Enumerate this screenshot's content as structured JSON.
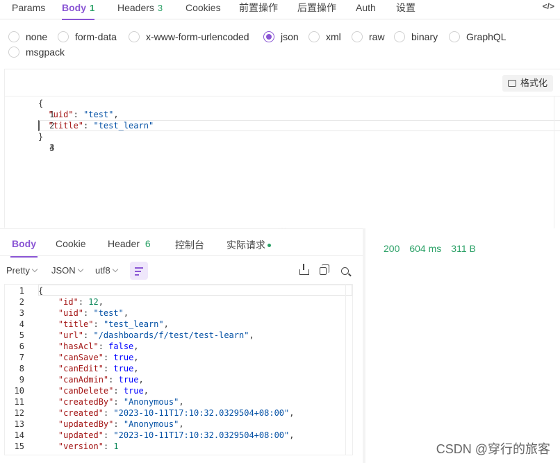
{
  "top_tabs": [
    {
      "label": "Params",
      "count": ""
    },
    {
      "label": "Body",
      "count": "1"
    },
    {
      "label": "Headers",
      "count": "3"
    },
    {
      "label": "Cookies",
      "count": ""
    },
    {
      "label": "前置操作",
      "count": ""
    },
    {
      "label": "后置操作",
      "count": ""
    },
    {
      "label": "Auth",
      "count": ""
    },
    {
      "label": "设置",
      "count": ""
    }
  ],
  "code_toggle": "</>",
  "body_types": [
    "none",
    "form-data",
    "x-www-form-urlencoded",
    "json",
    "xml",
    "raw",
    "binary",
    "GraphQL",
    "msgpack"
  ],
  "body_type_selected": "json",
  "format_button": "格式化",
  "request_body": {
    "line_numbers": [
      "1",
      "2",
      "3",
      "4"
    ],
    "lines": [
      {
        "t": "{"
      },
      {
        "k": "\"uid\"",
        "v": "\"test\"",
        "tail": ","
      },
      {
        "k": "\"title\"",
        "v": "\"test_learn\"",
        "tail": ""
      },
      {
        "t": "}"
      }
    ]
  },
  "split_handle": "···",
  "response_tabs": [
    {
      "label": "Body",
      "count": ""
    },
    {
      "label": "Cookie",
      "count": ""
    },
    {
      "label": "Header",
      "count": "6"
    },
    {
      "label": "控制台",
      "count": ""
    },
    {
      "label": "实际请求",
      "count": ""
    }
  ],
  "status": {
    "code": "200",
    "time": "604 ms",
    "size": "311 B"
  },
  "toolbar": {
    "pretty": "Pretty",
    "format": "JSON",
    "encoding": "utf8"
  },
  "response_body": {
    "lines": [
      {
        "t": "{"
      },
      {
        "k": "\"id\"",
        "v": "12",
        "vt": "num",
        "tail": ","
      },
      {
        "k": "\"uid\"",
        "v": "\"test\"",
        "vt": "str",
        "tail": ","
      },
      {
        "k": "\"title\"",
        "v": "\"test_learn\"",
        "vt": "str",
        "tail": ","
      },
      {
        "k": "\"url\"",
        "v": "\"/dashboards/f/test/test-learn\"",
        "vt": "str",
        "tail": ","
      },
      {
        "k": "\"hasAcl\"",
        "v": "false",
        "vt": "kw",
        "tail": ","
      },
      {
        "k": "\"canSave\"",
        "v": "true",
        "vt": "kw",
        "tail": ","
      },
      {
        "k": "\"canEdit\"",
        "v": "true",
        "vt": "kw",
        "tail": ","
      },
      {
        "k": "\"canAdmin\"",
        "v": "true",
        "vt": "kw",
        "tail": ","
      },
      {
        "k": "\"canDelete\"",
        "v": "true",
        "vt": "kw",
        "tail": ","
      },
      {
        "k": "\"createdBy\"",
        "v": "\"Anonymous\"",
        "vt": "str",
        "tail": ","
      },
      {
        "k": "\"created\"",
        "v": "\"2023-10-11T17:10:32.0329504+08:00\"",
        "vt": "str",
        "tail": ","
      },
      {
        "k": "\"updatedBy\"",
        "v": "\"Anonymous\"",
        "vt": "str",
        "tail": ","
      },
      {
        "k": "\"updated\"",
        "v": "\"2023-10-11T17:10:32.0329504+08:00\"",
        "vt": "str",
        "tail": ","
      },
      {
        "k": "\"version\"",
        "v": "1",
        "vt": "num",
        "tail": ""
      }
    ]
  },
  "watermark": "CSDN @穿行的旅客"
}
